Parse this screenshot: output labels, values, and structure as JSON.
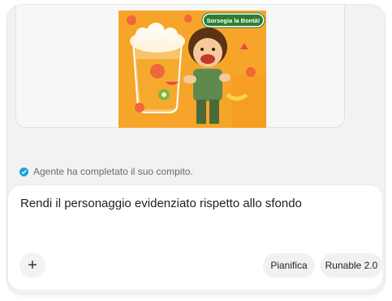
{
  "attachment": {
    "badge_text": "Sorsegia la Bontà!"
  },
  "status": {
    "icon": "check-circle-icon",
    "text": "Agente ha completato il suo compito."
  },
  "composer": {
    "input_value": "Rendi il personaggio evidenziato rispetto allo sfondo",
    "add_icon": "+",
    "plan_label": "Pianifica",
    "model_label": "Runable 2.0"
  },
  "colors": {
    "accent": "#1aa2d8",
    "illustration_bg": "#f7a52a"
  }
}
